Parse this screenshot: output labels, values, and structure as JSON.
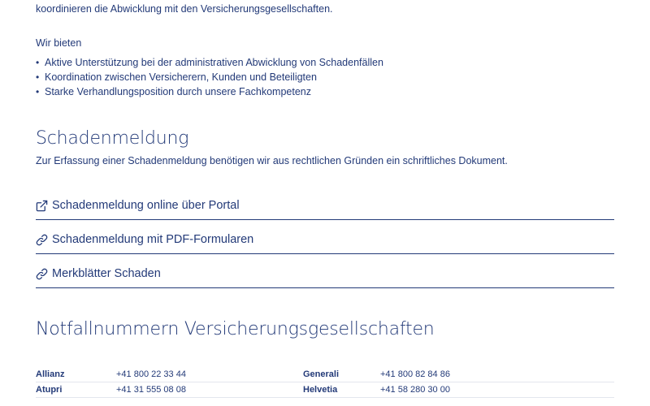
{
  "intro": {
    "text": "koordinieren die Abwicklung mit den Versicherungsgesellschaften."
  },
  "offer": {
    "title": "Wir bieten",
    "items": [
      "Aktive Unterstützung bei der administrativen Abwicklung von Schadenfällen",
      "Koordination zwischen Versicherern, Kunden und Beteiligten",
      "Starke Verhandlungsposition durch unsere Fachkompetenz"
    ]
  },
  "schadenmeldung": {
    "title": "Schadenmeldung",
    "description": "Zur Erfassung einer Schadenmeldung benötigen wir aus rechtlichen Gründen ein schriftliches Dokument.",
    "links": [
      {
        "label": "Schadenmeldung online über Portal",
        "icon": "external-link-icon"
      },
      {
        "label": "Schadenmeldung mit PDF-Formularen",
        "icon": "link-icon"
      },
      {
        "label": "Merkblätter Schaden",
        "icon": "link-icon"
      }
    ]
  },
  "notfall": {
    "title": "Notfallnummern Versicherungsgesellschaften",
    "rows": [
      {
        "left_name": "Allianz",
        "left_number": "+41 800 22 33 44",
        "right_name": "Generali",
        "right_number": "+41 800 82 84 86"
      },
      {
        "left_name": "Atupri",
        "left_number": "+41 31 555 08 08",
        "right_name": "Helvetia",
        "right_number": "+41 58 280 30 00"
      }
    ]
  },
  "colors": {
    "brand": "#233a78",
    "divider": "#e3e6ee",
    "background": "#ffffff"
  }
}
